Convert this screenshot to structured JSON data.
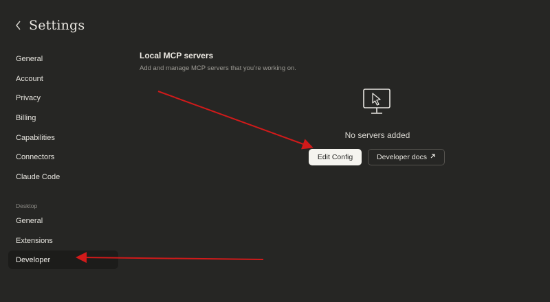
{
  "header": {
    "title": "Settings",
    "back_icon": "chevron-left-icon"
  },
  "sidebar": {
    "items": [
      {
        "label": "General"
      },
      {
        "label": "Account"
      },
      {
        "label": "Privacy"
      },
      {
        "label": "Billing"
      },
      {
        "label": "Capabilities"
      },
      {
        "label": "Connectors"
      },
      {
        "label": "Claude Code"
      }
    ],
    "section_label": "Desktop",
    "lower_items": [
      {
        "label": "General"
      },
      {
        "label": "Extensions"
      },
      {
        "label": "Developer",
        "active": true
      }
    ]
  },
  "main": {
    "title": "Local MCP servers",
    "description": "Add and manage MCP servers that you’re working on.",
    "empty_icon": "monitor-cursor-icon",
    "empty_text": "No servers added",
    "edit_config_label": "Edit Config",
    "developer_docs_label": "Developer docs",
    "developer_docs_icon": "external-arrow-icon"
  },
  "colors": {
    "background": "#262624",
    "active_item": "#1c1c1a",
    "primary_button": "#f5f4ef",
    "annotation_arrow": "#d11a1a"
  }
}
